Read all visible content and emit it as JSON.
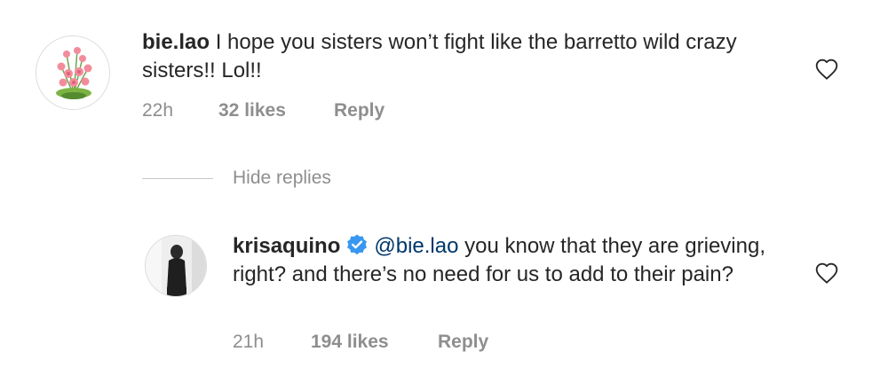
{
  "comments": [
    {
      "username": "bie.lao",
      "text": "I hope you sisters won’t fight like the barretto wild crazy sisters!! Lol!!",
      "time": "22h",
      "likes": "32 likes",
      "reply_label": "Reply"
    }
  ],
  "hide_replies_label": "Hide replies",
  "replies": [
    {
      "username": "krisaquino",
      "verified": true,
      "mention": "@bie.lao",
      "text": "you know that they are grieving, right? and there’s no need for us to add to their pain?",
      "time": "21h",
      "likes": "194 likes",
      "reply_label": "Reply"
    }
  ],
  "colors": {
    "text": "#262626",
    "meta": "#8e8e8e",
    "mention": "#00376b",
    "verified": "#3897f0"
  }
}
